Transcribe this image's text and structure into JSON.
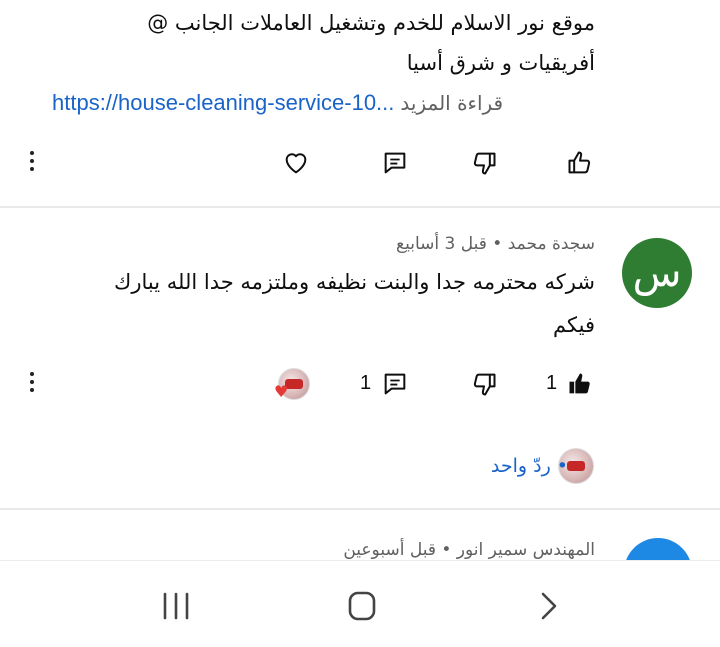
{
  "comment1": {
    "line1": "موقع نور الاسلام للخدم وتشغيل العاملات الجانب @",
    "line2": "أفريقيات  و شرق أسيا",
    "link": "https://house-cleaning-service-10...",
    "read_more": "قراءة المزيد"
  },
  "comment2": {
    "avatar_letter": "س",
    "avatar_color": "#2e7d32",
    "meta": "سجدة محمد • قبل 3 أسابيع",
    "text_line1": "شركه  محترمه جدا والبنت نظيفه وملتزمه جدا الله يبارك",
    "text_line2": "فيكم",
    "like_count": "1",
    "reply_count": "1",
    "reply_link": "• ردّ واحد"
  },
  "comment3": {
    "avatar_color": "#1e88e5",
    "meta": "المهندس سمير انور • قبل أسبوعين"
  },
  "icons": {
    "like": "thumbs-up-icon",
    "dislike": "thumbs-down-icon",
    "reply": "comment-icon",
    "heart": "heart-icon",
    "more": "more-vert-icon"
  },
  "accent_color": "#1a63c9"
}
